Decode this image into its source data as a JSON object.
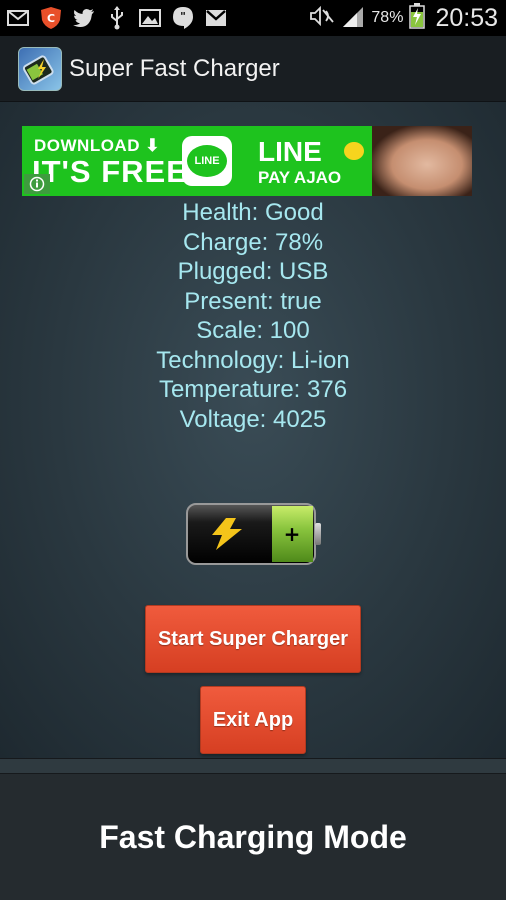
{
  "status_bar": {
    "icons": [
      "mail-icon",
      "shield-icon",
      "twitter-icon",
      "usb-icon",
      "image-icon",
      "hangouts-icon",
      "gmail-icon"
    ],
    "right_icons": [
      "mute-icon",
      "signal-icon",
      "battery-charging-icon"
    ],
    "battery_percent": "78%",
    "time": "20:53"
  },
  "action_bar": {
    "title": "Super Fast Charger",
    "icon": "battery-app-icon"
  },
  "ad": {
    "download": "DOWNLOAD ⬇",
    "free": "IT'S FREE!",
    "logo": "LINE",
    "brand": "LINE",
    "tagline": "PAY AJAO",
    "info_icon": "info-icon"
  },
  "battery_info": [
    "Health: Good",
    "Charge: 78%",
    "Plugged: USB",
    "Present: true",
    "Scale: 100",
    "Technology: Li-ion",
    "Temperature: 376",
    "Voltage: 4025"
  ],
  "battery_graphic": {
    "icon": "battery-graphic-icon",
    "level": 0.33,
    "plus_label": "+"
  },
  "buttons": {
    "start": "Start Super Charger",
    "exit": "Exit App"
  },
  "footer": {
    "mode": "Fast Charging Mode"
  },
  "colors": {
    "button": "#e74c2c",
    "info_text": "#a6e7ef",
    "ad_green": "#1ec31e"
  }
}
